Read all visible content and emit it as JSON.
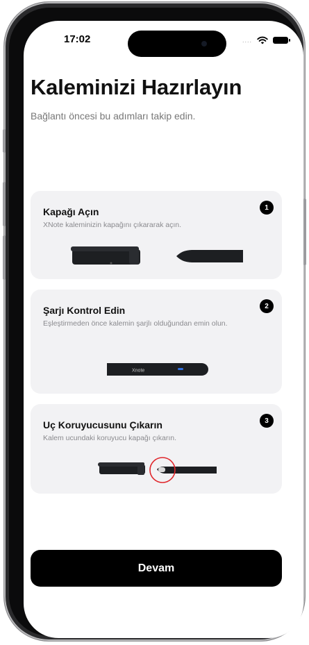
{
  "status_bar": {
    "time": "17:02",
    "signal": "....",
    "wifi_icon": "wifi-icon",
    "battery_icon": "battery-icon"
  },
  "header": {
    "title": "Kaleminizi Hazırlayın",
    "subtitle": "Bağlantı öncesi bu adımları takip edin."
  },
  "steps": [
    {
      "number": "1",
      "title": "Kapağı Açın",
      "description": "XNote kaleminizin kapağını çıkararak açın."
    },
    {
      "number": "2",
      "title": "Şarjı Kontrol Edin",
      "description": "Eşleştirmeden önce kalemin şarjlı olduğundan emin olun.",
      "pen_label": "Xnote"
    },
    {
      "number": "3",
      "title": "Uç Koruyucusunu Çıkarın",
      "description": "Kalem ucundaki koruyucu kapağı çıkarın."
    }
  ],
  "footer": {
    "continue_label": "Devam"
  },
  "colors": {
    "card_bg": "#f2f2f4",
    "button_bg": "#000000",
    "led": "#2f6fe0",
    "highlight_circle": "#e0262b"
  }
}
